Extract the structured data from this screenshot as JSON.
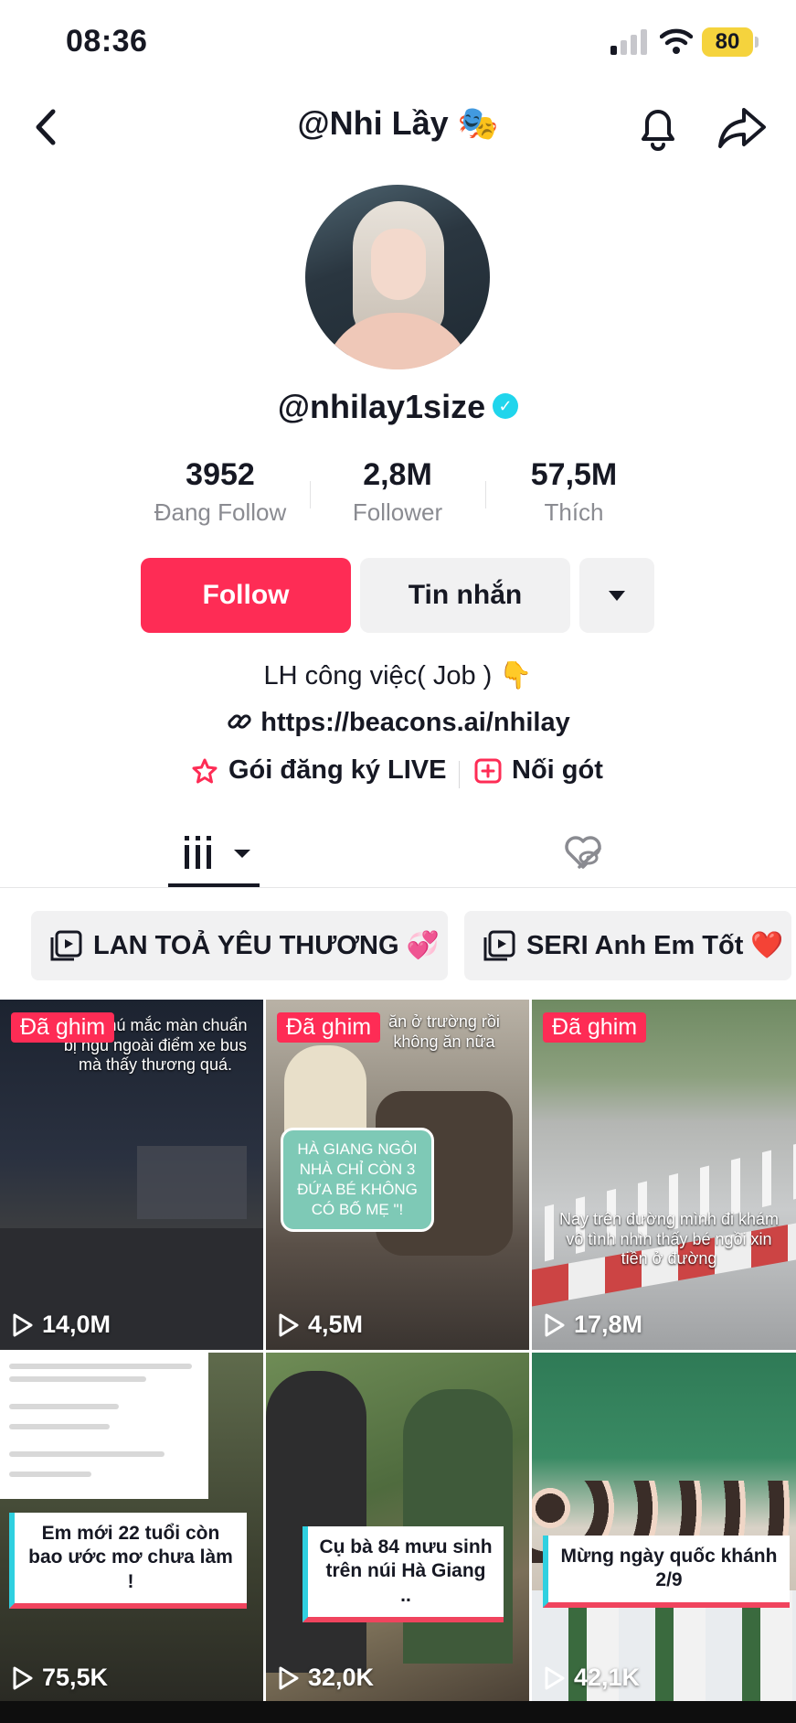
{
  "status_bar": {
    "time": "08:36",
    "battery": "80"
  },
  "header": {
    "title": "@Nhi Lầy 🎭"
  },
  "profile": {
    "username": "@nhilay1size",
    "stats": [
      {
        "value": "3952",
        "label": "Đang Follow"
      },
      {
        "value": "2,8M",
        "label": "Follower"
      },
      {
        "value": "57,5M",
        "label": "Thích"
      }
    ],
    "follow_label": "Follow",
    "message_label": "Tin nhắn",
    "bio": "LH công việc( Job ) 👇",
    "link": "https://beacons.ai/nhilay",
    "live_sub_label": "Gói đăng ký LIVE",
    "noi_got_label": "Nối gót"
  },
  "playlists": [
    "LAN TOẢ YÊU THƯƠNG 💞",
    "SERI Anh Em Tốt ❤️"
  ],
  "videos": [
    {
      "pinned": "Đã ghim",
      "views": "14,0M",
      "text": "thấy chú mắc màn chuẩn bị ngủ ngoài điểm xe bus mà thấy thương quá."
    },
    {
      "pinned": "Đã ghim",
      "views": "4,5M",
      "text": "HÀ GIANG NGÔI NHÀ CHỈ CÒN 3 ĐỨA BÉ KHÔNG CÓ BỐ MẸ \"!",
      "text2": "ăn ở trường rồi không ăn nữa"
    },
    {
      "pinned": "Đã ghim",
      "views": "17,8M",
      "text": "Nay trên đường mình đi khám vô tình nhìn thấy bé ngồi xin tiền ở đường"
    },
    {
      "views": "75,5K",
      "text": "Em mới 22 tuổi còn bao ước mơ chưa làm !"
    },
    {
      "views": "32,0K",
      "text": "Cụ bà 84 mưu sinh trên núi Hà Giang .."
    },
    {
      "views": "42,1K",
      "text": "Mừng ngày quốc khánh 2/9"
    }
  ]
}
